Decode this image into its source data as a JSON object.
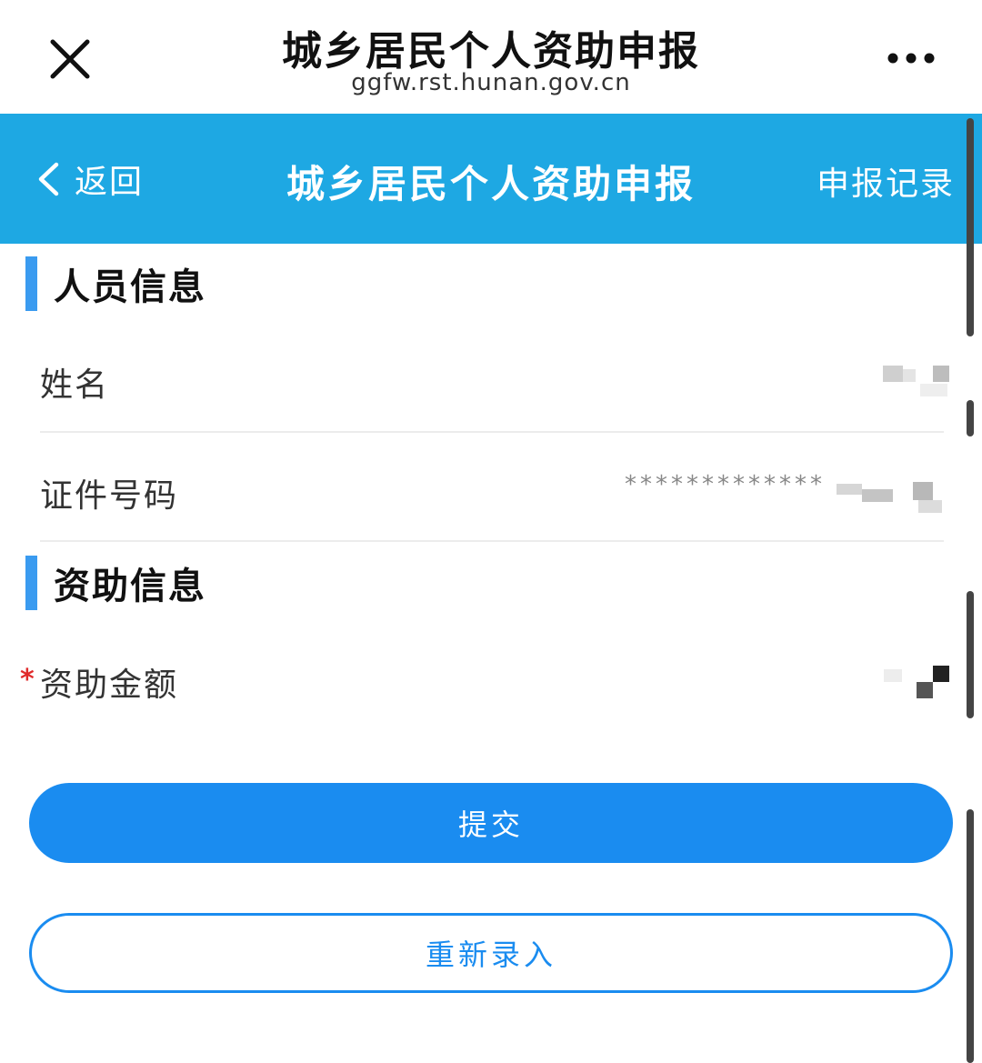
{
  "browser": {
    "title": "城乡居民个人资助申报",
    "url": "ggfw.rst.hunan.gov.cn",
    "close_icon": "close-icon",
    "more_icon": "more-icon"
  },
  "header": {
    "back_label": "返回",
    "title": "城乡居民个人资助申报",
    "records_label": "申报记录",
    "color": "#1ea8e3"
  },
  "personal_section": {
    "title": "人员信息",
    "fields": [
      {
        "label": "姓名"
      },
      {
        "label": "证件号码",
        "value": "*************"
      }
    ]
  },
  "funding_section": {
    "title": "资助信息",
    "fields": [
      {
        "label": "资助金额",
        "required_mark": "*"
      }
    ]
  },
  "actions": {
    "submit_label": "提交",
    "reset_label": "重新录入",
    "accent": "#1a8cf0"
  }
}
